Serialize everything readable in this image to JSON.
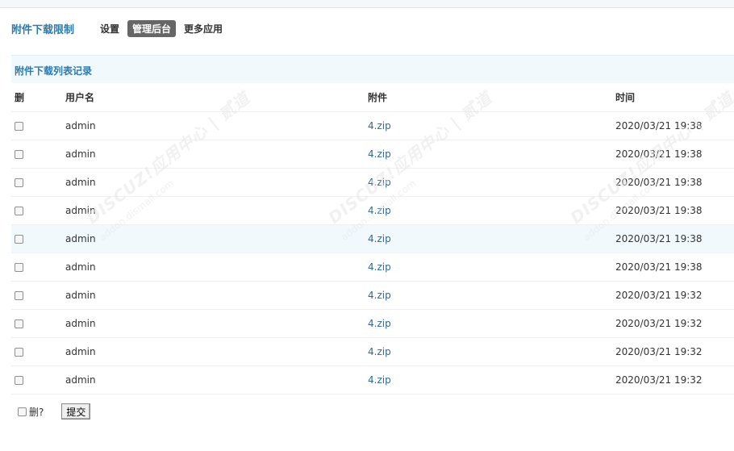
{
  "header": {
    "plugin_title": "附件下载限制",
    "nav": [
      "设置",
      "管理后台",
      "更多应用"
    ],
    "active_nav": "管理后台"
  },
  "section": {
    "title": "附件下载列表记录"
  },
  "table": {
    "columns": [
      "删",
      "用户名",
      "附件",
      "时间"
    ],
    "rows": [
      {
        "user": "admin",
        "file": "4.zip",
        "time": "2020/03/21 19:38"
      },
      {
        "user": "admin",
        "file": "4.zip",
        "time": "2020/03/21 19:38"
      },
      {
        "user": "admin",
        "file": "4.zip",
        "time": "2020/03/21 19:38"
      },
      {
        "user": "admin",
        "file": "4.zip",
        "time": "2020/03/21 19:38"
      },
      {
        "user": "admin",
        "file": "4.zip",
        "time": "2020/03/21 19:38"
      },
      {
        "user": "admin",
        "file": "4.zip",
        "time": "2020/03/21 19:38"
      },
      {
        "user": "admin",
        "file": "4.zip",
        "time": "2020/03/21 19:32"
      },
      {
        "user": "admin",
        "file": "4.zip",
        "time": "2020/03/21 19:32"
      },
      {
        "user": "admin",
        "file": "4.zip",
        "time": "2020/03/21 19:32"
      },
      {
        "user": "admin",
        "file": "4.zip",
        "time": "2020/03/21 19:32"
      }
    ]
  },
  "footer": {
    "delete_label": "删?",
    "submit_label": "提交"
  },
  "watermark": {
    "brand": "DISCUZ!应用中心 | 贰道",
    "url": "addon.dismall.com"
  },
  "colors": {
    "accent": "#2b7ab0",
    "link": "#2b6a9e",
    "active_nav_bg": "#666666",
    "section_bg": "#f2f9fd"
  }
}
